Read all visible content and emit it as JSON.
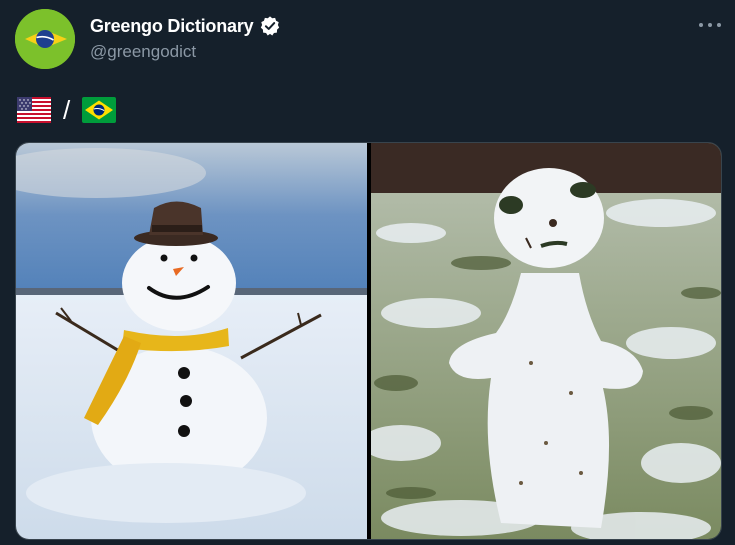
{
  "account": {
    "display_name": "Greengo Dictionary",
    "handle": "@greengodict",
    "verified": true,
    "avatar_icon": "brazil-flag-avatar-icon"
  },
  "header": {
    "more_icon": "more-horizontal-icon"
  },
  "tweet": {
    "flag_left": "us-flag-icon",
    "separator": "/",
    "flag_right": "brazil-flag-icon"
  },
  "media": {
    "photos": [
      {
        "name": "photo-snowman-classic",
        "description_icon": "snowman-image"
      },
      {
        "name": "photo-snowman-lumpy",
        "description_icon": "snowman-image"
      }
    ]
  },
  "colors": {
    "background": "#15202b",
    "secondary_text": "#8b98a5",
    "border": "#38444d",
    "avatar_green": "#7cc12b"
  }
}
